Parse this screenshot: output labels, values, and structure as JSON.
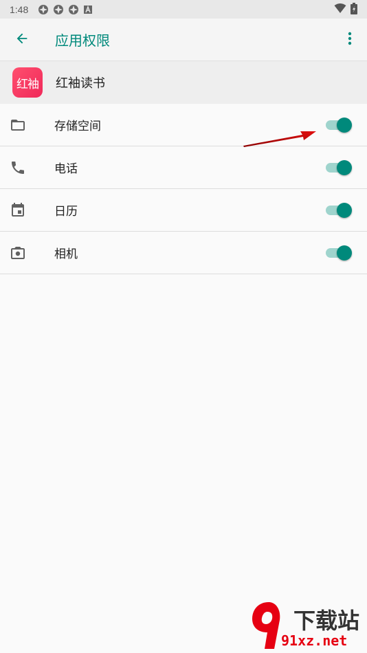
{
  "status_bar": {
    "time": "1:48",
    "icons": [
      "app-notification-icon",
      "app-notification-icon",
      "app-notification-icon",
      "keyboard-a-icon"
    ],
    "right_icons": [
      "wifi-icon",
      "battery-icon"
    ]
  },
  "app_bar": {
    "title": "应用权限",
    "back_icon": "arrow-back-icon",
    "menu_icon": "more-vert-icon"
  },
  "app": {
    "name": "红袖读书",
    "logo_text": "红袖"
  },
  "permissions": [
    {
      "label": "存储空间",
      "icon": "folder-icon",
      "enabled": true
    },
    {
      "label": "电话",
      "icon": "phone-icon",
      "enabled": true
    },
    {
      "label": "日历",
      "icon": "calendar-icon",
      "enabled": true
    },
    {
      "label": "相机",
      "icon": "camera-icon",
      "enabled": true
    }
  ],
  "watermark": {
    "text": "下载站",
    "url": "91xz.net"
  },
  "colors": {
    "accent": "#00897b",
    "track": "#9fd4cd",
    "logo": "#f0295a"
  }
}
